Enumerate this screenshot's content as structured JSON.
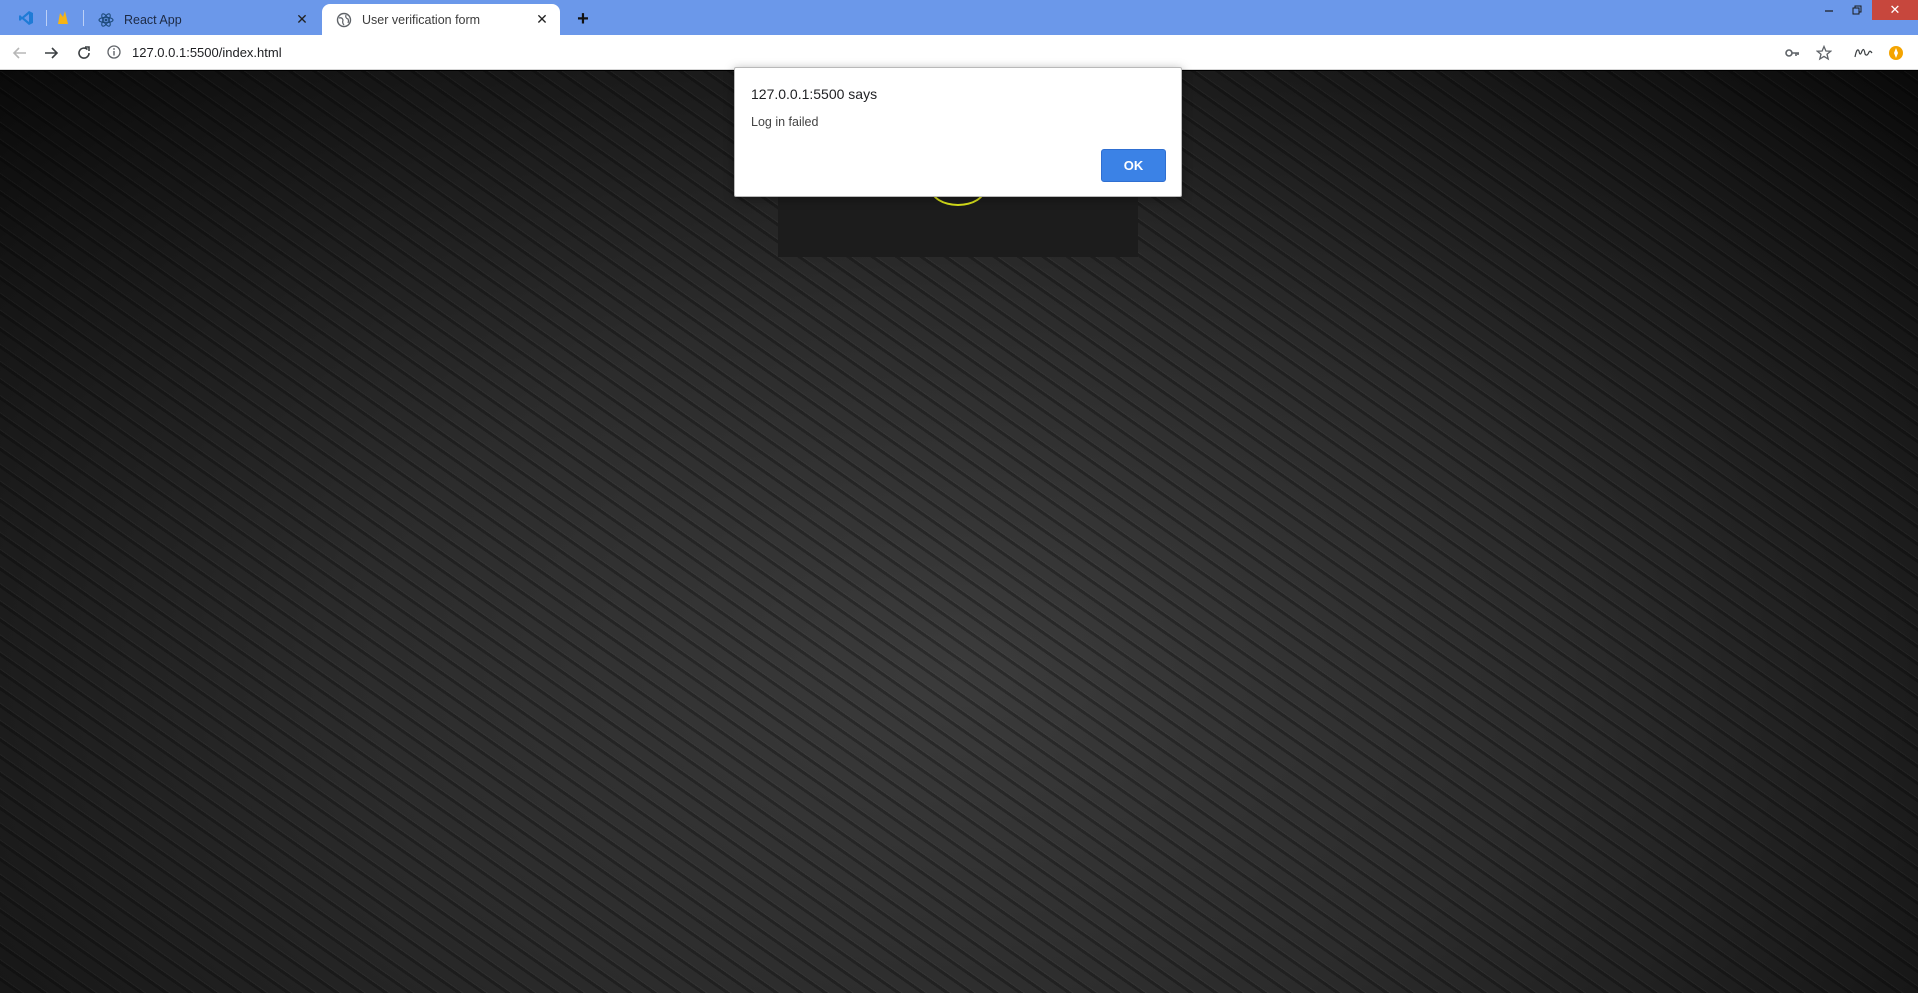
{
  "browser": {
    "tabs": [
      {
        "label": "React App",
        "favicon": "react-icon"
      },
      {
        "label": "User verification form",
        "favicon": "globe-icon",
        "active": true
      }
    ],
    "pinned_tabs": [
      {
        "favicon": "vscode-icon"
      },
      {
        "favicon": "flame-icon"
      }
    ],
    "new_tab_icon": "plus-icon",
    "address": "127.0.0.1:5500/index.html",
    "toolbar_icons": [
      "back-icon",
      "forward-icon",
      "reload-icon",
      "info-icon",
      "key-icon",
      "star-icon",
      "profile-icon",
      "extension-icon"
    ],
    "accent_color": "#6b98ea"
  },
  "alert": {
    "title": "127.0.0.1:5500 says",
    "message": "Log in failed",
    "ok_label": "OK",
    "button_color": "#3b82e6"
  },
  "page": {
    "background": "dark diagonal striped",
    "card_accent": "#d8e11a"
  }
}
